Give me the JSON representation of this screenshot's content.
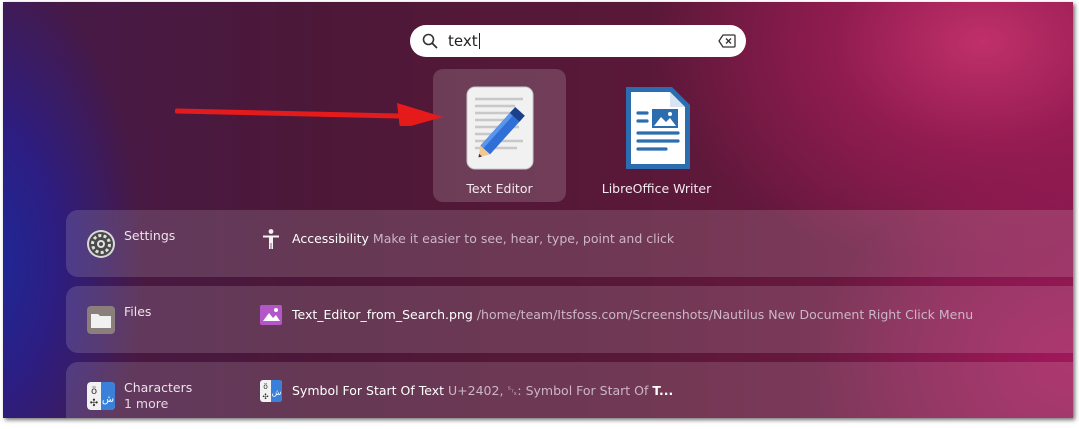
{
  "search": {
    "value": "text",
    "icon": "search-icon",
    "clear_icon": "clear-text-icon"
  },
  "apps": [
    {
      "name": "Text Editor",
      "icon": "text-editor-icon",
      "selected": true
    },
    {
      "name": "LibreOffice Writer",
      "icon": "libreoffice-writer-icon",
      "selected": false
    }
  ],
  "annotation": {
    "color": "#e51b1b",
    "icon": "red-arrow"
  },
  "providers": [
    {
      "name": "Settings",
      "icon": "settings-gear-icon",
      "result": {
        "icon": "accessibility-icon",
        "title": "Accessibility",
        "description": "Make it easier to see, hear, type, point and click"
      }
    },
    {
      "name": "Files",
      "icon": "files-folder-icon",
      "result": {
        "icon": "image-file-icon",
        "title": "Text_Editor_from_Search.png",
        "description": "/home/team/Itsfoss.com/Screenshots/Nautilus New  Document Right Click Menu"
      }
    },
    {
      "name": "Characters",
      "more": "1 more",
      "icon": "characters-app-icon",
      "result": {
        "icon": "characters-app-icon",
        "title": "Symbol For Start Of Text",
        "description": "U+2402, ␂: Symbol For Start Of ",
        "description_bold": "T..."
      }
    }
  ]
}
